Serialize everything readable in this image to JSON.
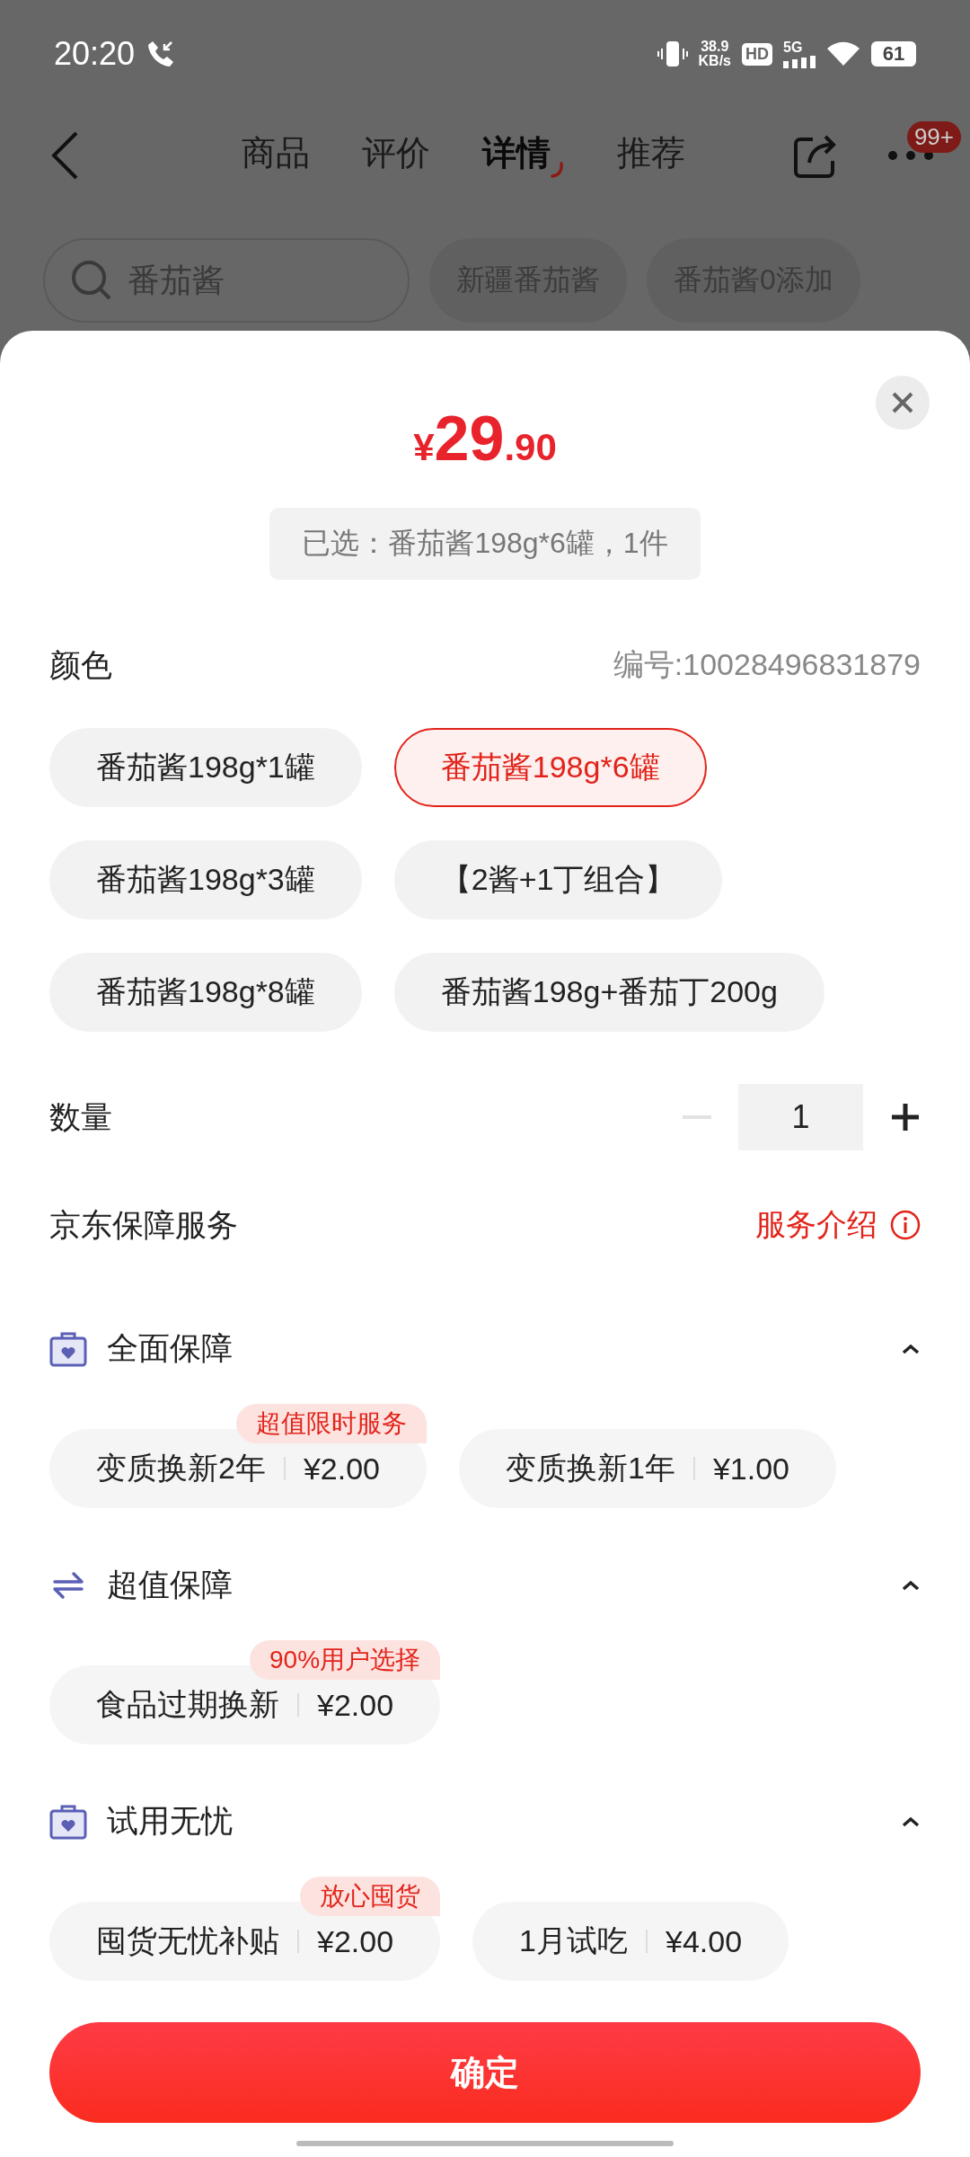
{
  "status_bar": {
    "time": "20:20",
    "net_speed": "38.9",
    "net_unit": "KB/s",
    "hd": "HD",
    "network": "5G",
    "battery": "61"
  },
  "nav": {
    "tabs": [
      {
        "label": "商品",
        "selected": false
      },
      {
        "label": "评价",
        "selected": false
      },
      {
        "label": "详情",
        "selected": true
      },
      {
        "label": "推荐",
        "selected": false
      }
    ],
    "badge": "99+"
  },
  "search": {
    "value": "番茄酱",
    "suggestions": [
      "新疆番茄酱",
      "番茄酱0添加"
    ]
  },
  "sheet": {
    "price": {
      "currency": "¥",
      "integer": "29",
      "decimal": ".90"
    },
    "summary": "已选：番茄酱198g*6罐，1件",
    "spec_label": "颜色",
    "sku": "编号:10028496831879",
    "options": [
      {
        "label": "番茄酱198g*1罐",
        "selected": false
      },
      {
        "label": "番茄酱198g*6罐",
        "selected": true
      },
      {
        "label": "番茄酱198g*3罐",
        "selected": false
      },
      {
        "label": "【2酱+1丁组合】",
        "selected": false
      },
      {
        "label": "番茄酱198g*8罐",
        "selected": false
      },
      {
        "label": "番茄酱198g+番茄丁200g",
        "selected": false
      }
    ],
    "quantity": {
      "label": "数量",
      "value": "1",
      "decrease_disabled": true
    },
    "services": {
      "title": "京东保障服务",
      "link": "服务介绍"
    },
    "groups": [
      {
        "title": "全面保障",
        "kind": "case",
        "expanded": true,
        "items": [
          {
            "name": "变质换新2年",
            "price": "¥2.00",
            "tag": "超值限时服务"
          },
          {
            "name": "变质换新1年",
            "price": "¥1.00"
          }
        ]
      },
      {
        "title": "超值保障",
        "kind": "swap",
        "expanded": true,
        "items": [
          {
            "name": "食品过期换新",
            "price": "¥2.00",
            "tag": "90%用户选择"
          }
        ]
      },
      {
        "title": "试用无忧",
        "kind": "case",
        "expanded": true,
        "items": [
          {
            "name": "囤货无忧补贴",
            "price": "¥2.00",
            "tag": "放心囤货"
          },
          {
            "name": "1月试吃",
            "price": "¥4.00"
          }
        ]
      }
    ],
    "confirm": "确定"
  }
}
